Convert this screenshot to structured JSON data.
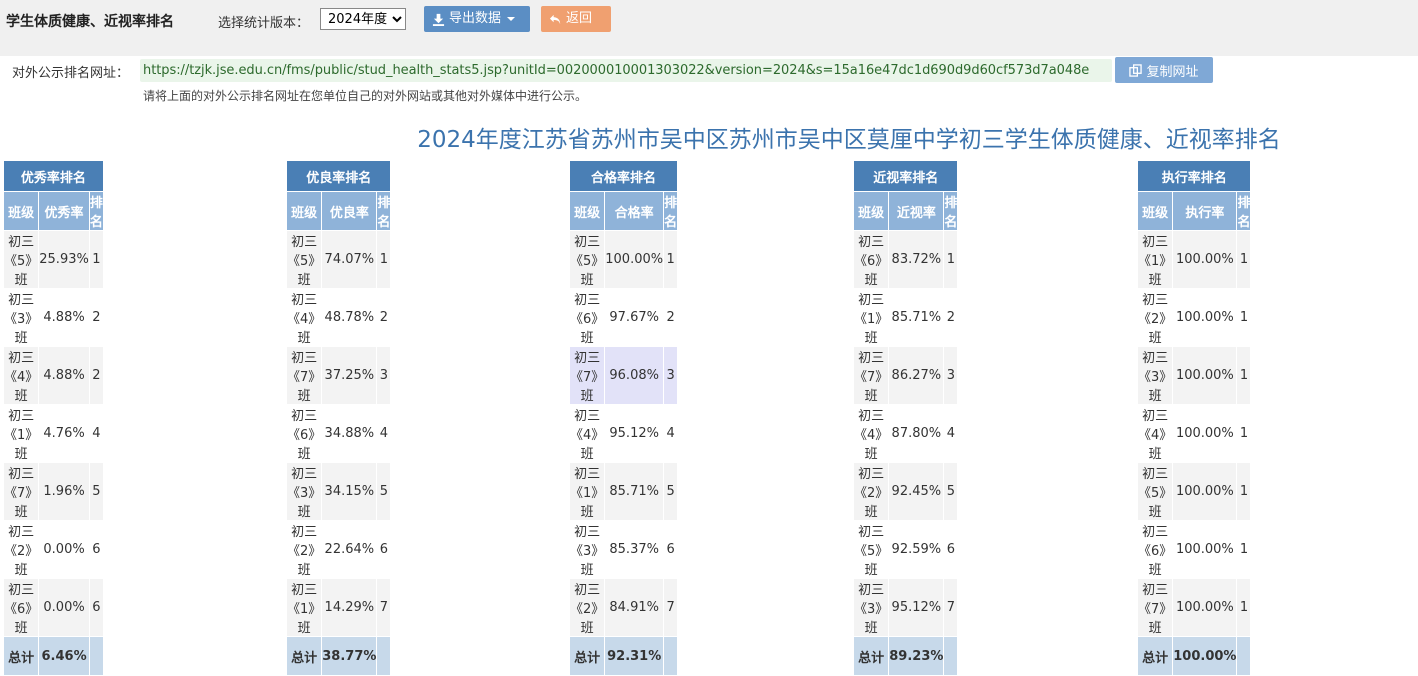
{
  "header": {
    "title": "学生体质健康、近视率排名",
    "version_label": "选择统计版本：",
    "version_selected": "2024年度",
    "export_label": "导出数据",
    "back_label": "返回"
  },
  "public_url": {
    "label": "对外公示排名网址：",
    "url": "https://tzjk.jse.edu.cn/fms/public/stud_health_stats5.jsp?unitId=002000010001303022&version=2024&s=15a16e47dc1d690d9d60cf573d7a048e",
    "copy_label": "复制网址",
    "hint": "请将上面的对外公示排名网址在您单位自己的对外网站或其他对外媒体中进行公示。"
  },
  "report_title": "2024年度江苏省苏州市吴中区苏州市吴中区莫厘中学初三学生体质健康、近视率排名",
  "tables": [
    {
      "group": "优秀率排名",
      "columns": [
        "班级",
        "优秀率",
        "排名"
      ],
      "rows": [
        [
          "初三《5》班",
          "25.93%",
          "1"
        ],
        [
          "初三《3》班",
          "4.88%",
          "2"
        ],
        [
          "初三《4》班",
          "4.88%",
          "2"
        ],
        [
          "初三《1》班",
          "4.76%",
          "4"
        ],
        [
          "初三《7》班",
          "1.96%",
          "5"
        ],
        [
          "初三《2》班",
          "0.00%",
          "6"
        ],
        [
          "初三《6》班",
          "0.00%",
          "6"
        ]
      ],
      "total": [
        "总计",
        "6.46%",
        ""
      ]
    },
    {
      "group": "优良率排名",
      "columns": [
        "班级",
        "优良率",
        "排名"
      ],
      "rows": [
        [
          "初三《5》班",
          "74.07%",
          "1"
        ],
        [
          "初三《4》班",
          "48.78%",
          "2"
        ],
        [
          "初三《7》班",
          "37.25%",
          "3"
        ],
        [
          "初三《6》班",
          "34.88%",
          "4"
        ],
        [
          "初三《3》班",
          "34.15%",
          "5"
        ],
        [
          "初三《2》班",
          "22.64%",
          "6"
        ],
        [
          "初三《1》班",
          "14.29%",
          "7"
        ]
      ],
      "total": [
        "总计",
        "38.77%",
        ""
      ]
    },
    {
      "group": "合格率排名",
      "columns": [
        "班级",
        "合格率",
        "排名"
      ],
      "rows": [
        [
          "初三《5》班",
          "100.00%",
          "1"
        ],
        [
          "初三《6》班",
          "97.67%",
          "2"
        ],
        [
          "初三《7》班",
          "96.08%",
          "3"
        ],
        [
          "初三《4》班",
          "95.12%",
          "4"
        ],
        [
          "初三《1》班",
          "85.71%",
          "5"
        ],
        [
          "初三《3》班",
          "85.37%",
          "6"
        ],
        [
          "初三《2》班",
          "84.91%",
          "7"
        ]
      ],
      "total": [
        "总计",
        "92.31%",
        ""
      ]
    },
    {
      "group": "近视率排名",
      "columns": [
        "班级",
        "近视率",
        "排名"
      ],
      "rows": [
        [
          "初三《6》班",
          "83.72%",
          "1"
        ],
        [
          "初三《1》班",
          "85.71%",
          "2"
        ],
        [
          "初三《7》班",
          "86.27%",
          "3"
        ],
        [
          "初三《4》班",
          "87.80%",
          "4"
        ],
        [
          "初三《2》班",
          "92.45%",
          "5"
        ],
        [
          "初三《5》班",
          "92.59%",
          "6"
        ],
        [
          "初三《3》班",
          "95.12%",
          "7"
        ]
      ],
      "total": [
        "总计",
        "89.23%",
        ""
      ]
    },
    {
      "group": "执行率排名",
      "columns": [
        "班级",
        "执行率",
        "排名"
      ],
      "rows": [
        [
          "初三《1》班",
          "100.00%",
          "1"
        ],
        [
          "初三《2》班",
          "100.00%",
          "1"
        ],
        [
          "初三《3》班",
          "100.00%",
          "1"
        ],
        [
          "初三《4》班",
          "100.00%",
          "1"
        ],
        [
          "初三《5》班",
          "100.00%",
          "1"
        ],
        [
          "初三《6》班",
          "100.00%",
          "1"
        ],
        [
          "初三《7》班",
          "100.00%",
          "1"
        ]
      ],
      "total": [
        "总计",
        "100.00%",
        ""
      ]
    }
  ],
  "highlighted_row": {
    "table": 2,
    "row": 2
  },
  "colors": {
    "group_header": "#4a7fb5",
    "column_header": "#8fb3d9",
    "total_row": "#c7d9ea",
    "highlight_row": "#e2e2f8",
    "title_text": "#3b73ad"
  }
}
